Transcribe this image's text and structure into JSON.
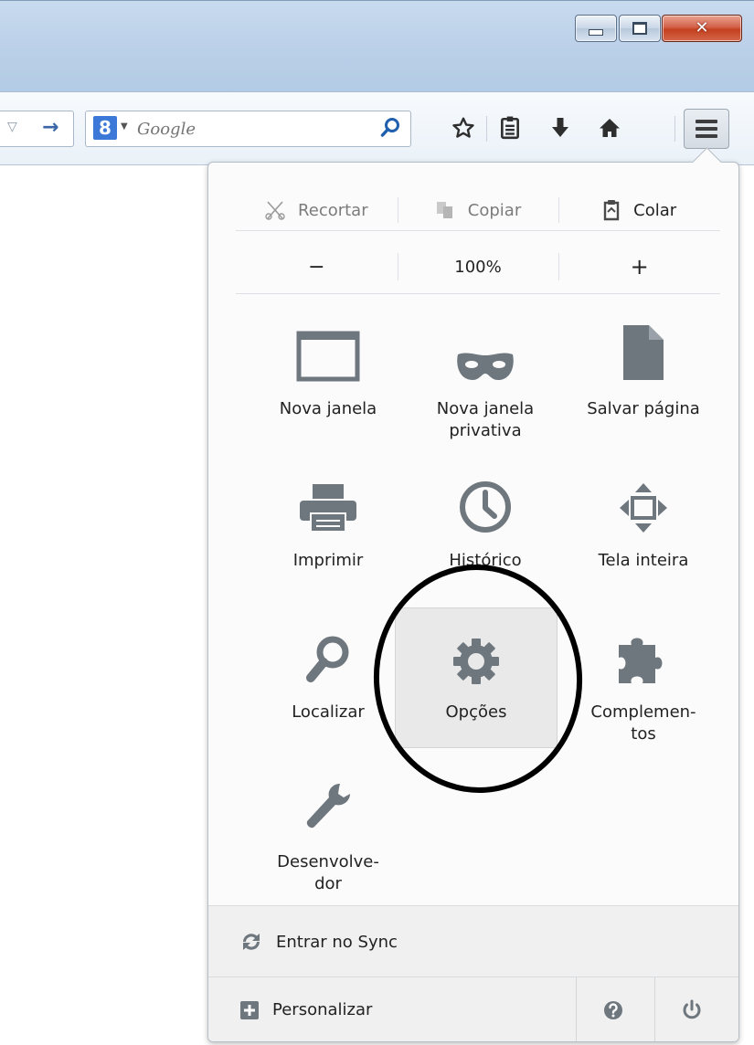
{
  "search": {
    "engine_letter": "8",
    "placeholder": "Google"
  },
  "menu": {
    "edit": {
      "cut": "Recortar",
      "copy": "Copiar",
      "paste": "Colar"
    },
    "zoom": {
      "out": "−",
      "level": "100%",
      "in": "+"
    },
    "items": [
      {
        "label": "Nova janela",
        "icon": "window-icon"
      },
      {
        "label": "Nova janela privativa",
        "icon": "mask-icon"
      },
      {
        "label": "Salvar página",
        "icon": "page-icon"
      },
      {
        "label": "Imprimir",
        "icon": "printer-icon"
      },
      {
        "label": "Histórico",
        "icon": "clock-icon"
      },
      {
        "label": "Tela inteira",
        "icon": "fullscreen-icon"
      },
      {
        "label": "Localizar",
        "icon": "search-icon"
      },
      {
        "label": "Opções",
        "icon": "gear-icon"
      },
      {
        "label": "Complemen-tos",
        "icon": "puzzle-icon"
      },
      {
        "label": "Desenvolve-dor",
        "icon": "wrench-icon"
      }
    ],
    "sync": "Entrar no Sync",
    "customize": "Personalizar"
  },
  "colors": {
    "icon_gray": "#6e767e",
    "accent_blue": "#3c78d8",
    "close_red": "#c3401f"
  }
}
